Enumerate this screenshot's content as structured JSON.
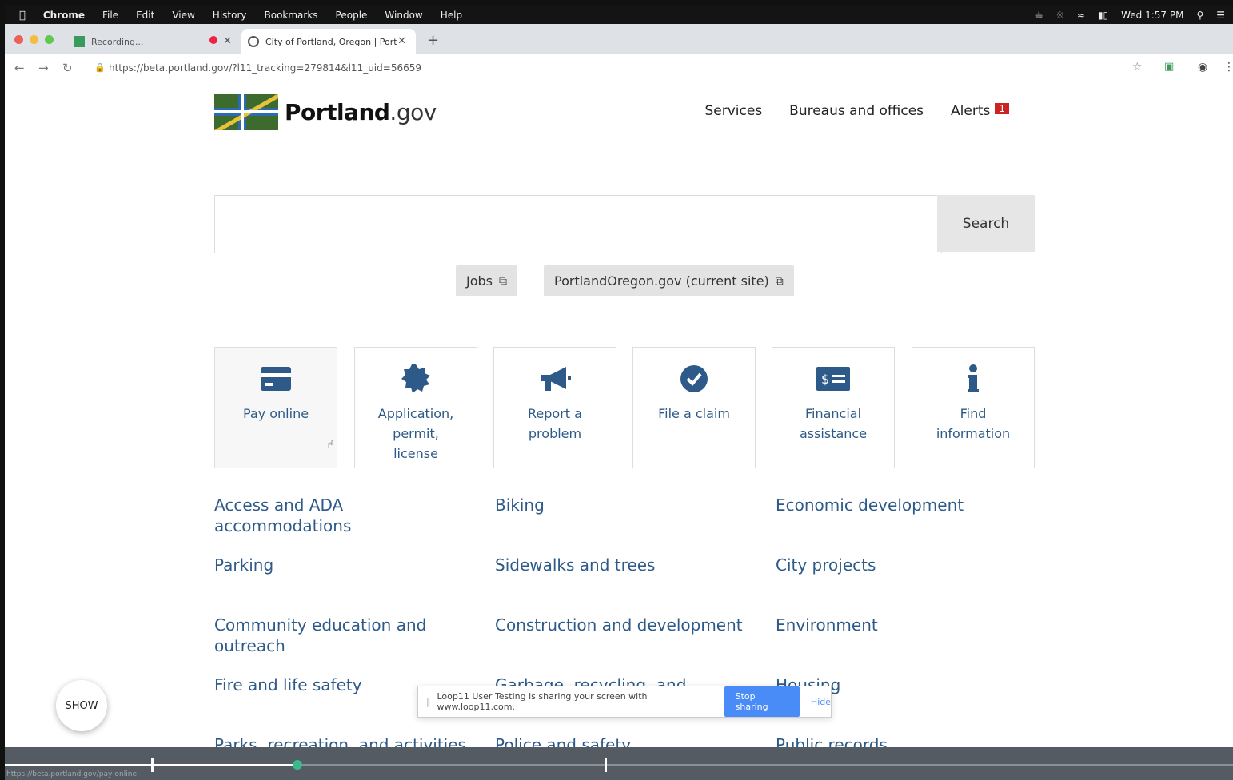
{
  "menubar": {
    "app": "Chrome",
    "items": [
      "File",
      "Edit",
      "View",
      "History",
      "Bookmarks",
      "People",
      "Window",
      "Help"
    ],
    "clock": "Wed 1:57 PM"
  },
  "tabs": [
    {
      "title": "Recording..."
    },
    {
      "title": "City of Portland, Oregon | Port"
    }
  ],
  "toolbar": {
    "url": "https://beta.portland.gov/?l11_tracking=279814&l11_uid=56659"
  },
  "site": {
    "logo_word": "Portland",
    "logo_suffix": ".gov",
    "nav": {
      "services": "Services",
      "bureaus": "Bureaus and offices",
      "alerts": "Alerts",
      "alerts_count": "1"
    },
    "search": {
      "placeholder": "",
      "button": "Search"
    },
    "external": {
      "jobs": "Jobs",
      "legacy": "PortlandOregon.gov (current site)"
    },
    "cards": [
      {
        "label": "Pay online",
        "icon": "credit-card-icon"
      },
      {
        "label": "Application, permit, license",
        "icon": "badge-icon"
      },
      {
        "label": "Report a problem",
        "icon": "megaphone-icon"
      },
      {
        "label": "File a claim",
        "icon": "check-circle-icon"
      },
      {
        "label": "Financial assistance",
        "icon": "money-bill-icon"
      },
      {
        "label": "Find information",
        "icon": "info-icon"
      }
    ],
    "topics": [
      "Access and ADA accommodations",
      "Biking",
      "Economic development",
      "Parking",
      "Sidewalks and trees",
      "City projects",
      "Community education and outreach",
      "Construction and development",
      "Environment",
      "Fire and life safety",
      "Garbage, recycling, and composting",
      "Housing",
      "Parks, recreation, and activities",
      "Police and safety",
      "Public records"
    ]
  },
  "overlay": {
    "show": "SHOW",
    "share_text": "Loop11 User Testing is sharing your screen with www.loop11.com.",
    "stop_sharing": "Stop sharing",
    "hide": "Hide",
    "status_url": "https://beta.portland.gov/pay-online"
  },
  "colors": {
    "link": "#2d5a88",
    "logo_green": "#3d6b2e",
    "logo_blue": "#2d6bb0",
    "logo_yellow": "#e8c23a",
    "alert": "#cc2222",
    "share_button": "#4a8cf7"
  }
}
